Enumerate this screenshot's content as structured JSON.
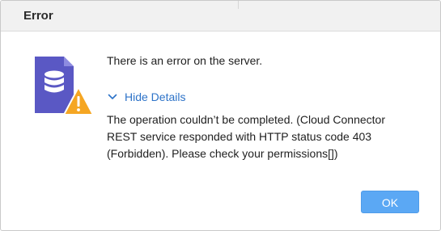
{
  "dialog": {
    "title": "Error",
    "icon": "database-warning-icon",
    "message": "There is an error on the server.",
    "details_toggle_label": "Hide Details",
    "details_text": "The operation couldn’t be completed. (Cloud Connector REST service responded with HTTP status code 403 (Forbidden). Please check your permissions[])",
    "ok_label": "OK"
  },
  "colors": {
    "accent": "#2d73c8",
    "button": "#5ba8f4",
    "doc_icon": "#5a58c4",
    "warning": "#f5a623"
  }
}
